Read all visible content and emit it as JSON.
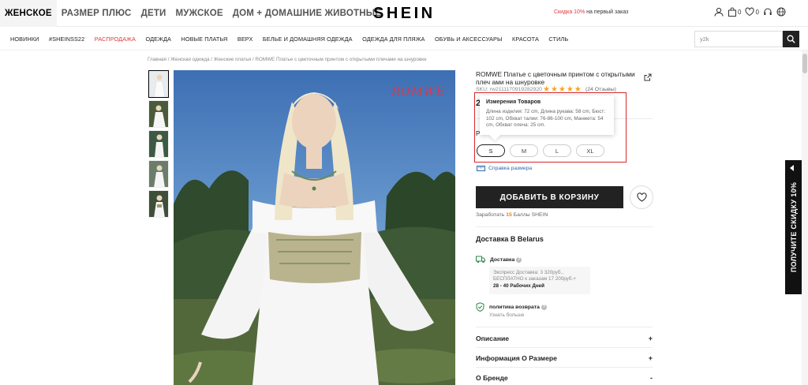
{
  "header": {
    "categories": [
      "ЖЕНСКОЕ",
      "РАЗМЕР ПЛЮС",
      "ДЕТИ",
      "МУЖСКОЕ",
      "ДОМ + ДОМАШНИЕ ЖИВОТНЫЕ"
    ],
    "logo": "SHEIN",
    "promo_red": "Скидка 10%",
    "promo_rest": " на первый заказ",
    "bag_count": "0",
    "wishlist_count": "0"
  },
  "nav": {
    "items": [
      "НОВИНКИ",
      "#SHEINSS22",
      "РАСПРОДАЖА",
      "ОДЕЖДА",
      "НОВЫЕ ПЛАТЬЯ",
      "ВЕРХ",
      "БЕЛЬЕ И ДОМАШНЯЯ ОДЕЖДА",
      "ОДЕЖДА ДЛЯ ПЛЯЖА",
      "ОБУВЬ И АКСЕССУАРЫ",
      "КРАСОТА",
      "СТИЛЬ"
    ],
    "sale_color": "#e13a3a",
    "search_value": "y2k"
  },
  "breadcrumb": "Главная / Женская одежда / Женские платья / ROMWE Платье с цветочным принтом с открытыми плечами на шнуровке",
  "product": {
    "brand_watermark": "ROMWE",
    "title": "ROMWE Платье с цветочным принтом с открытыми плеч ами на шнуровке",
    "sku": "SKU: rw2111170919282920",
    "rating": 5,
    "reviews": "(24 Отзывы)",
    "price_partial": "2",
    "size_label_partial": "Р"
  },
  "tooltip": {
    "title": "Измерения Товаров",
    "body": "Длина изделия: 72 cm, Длина рукава: 58 cm, Бюст: 102 cm, Обхват талии: 76-86-100 cm, Манжета: 54 cm, Обхват плеча: 25 cm."
  },
  "sizes": [
    {
      "label": "S",
      "selected": true
    },
    {
      "label": "M",
      "selected": false
    },
    {
      "label": "L",
      "selected": false
    },
    {
      "label": "XL",
      "selected": false
    }
  ],
  "size_guide": "Справка размера",
  "add_to_cart": "ДОБАВИТЬ В КОРЗИНУ",
  "points": {
    "pre": "Заработать ",
    "value": "15",
    "post": " Баллы SHEIN"
  },
  "delivery": {
    "title": "Доставка В Belarus",
    "shipping_label": "Доставка",
    "express_line1": "Экспресс Доставка: 3 320руб.,",
    "express_line2": "БЕСПЛАТНО к заказам 17 200руб.+",
    "days": "28 - 40 Рабочих Дней",
    "return_label": "политика возврата",
    "learn_more": "Узнать больше"
  },
  "accordion": [
    {
      "title": "Описание",
      "sign": "+"
    },
    {
      "title": "Информация О Размере",
      "sign": "+"
    },
    {
      "title": "О Бренде",
      "sign": "-"
    }
  ],
  "side_promo": "ПОЛУЧИТЕ СКИДКУ 10%",
  "colors": {
    "accent_red": "#d9262e",
    "dark": "#222222",
    "link": "#2d68a8",
    "star": "#f5a623"
  }
}
